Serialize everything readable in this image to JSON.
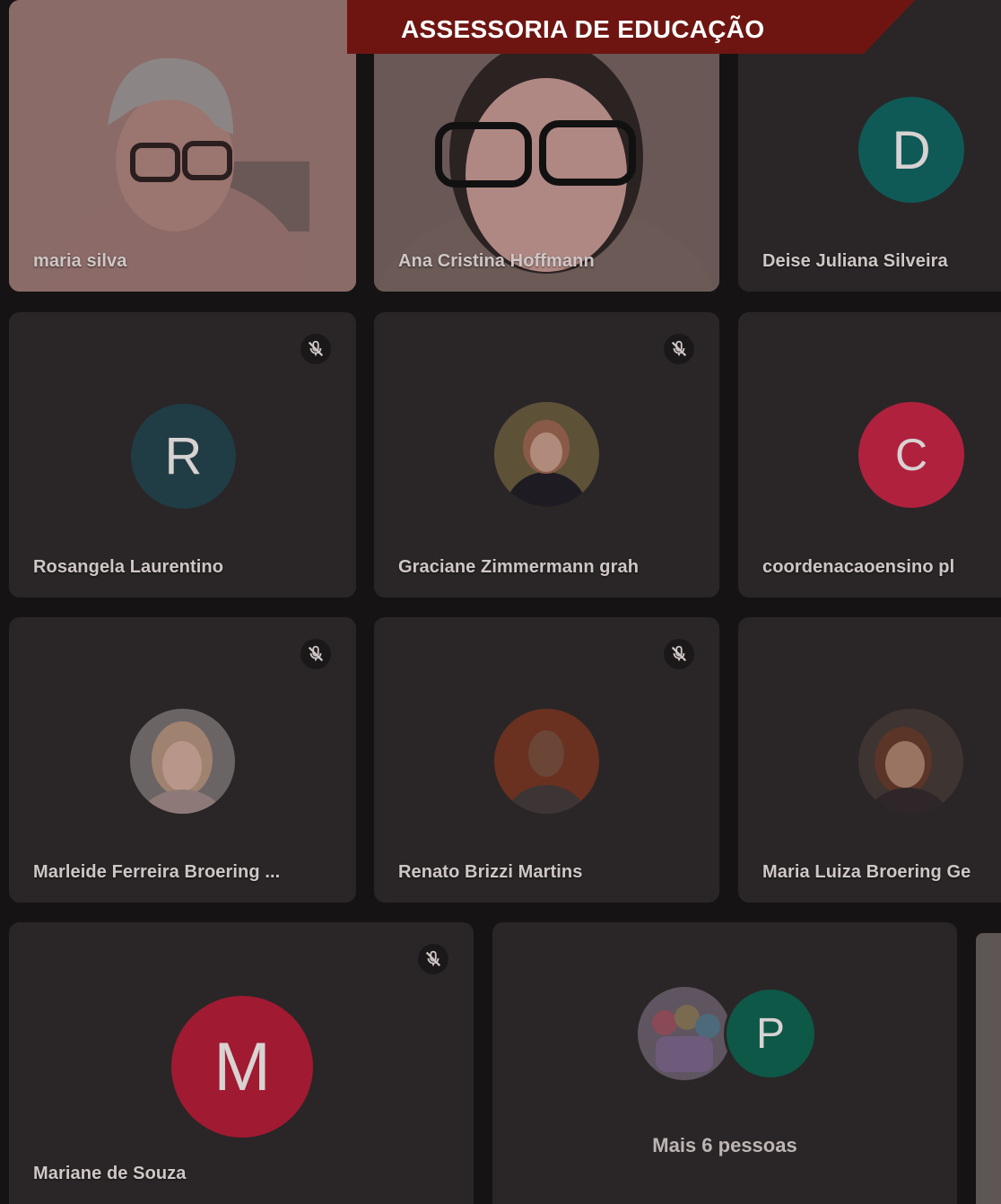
{
  "banner": {
    "text": "ASSESSORIA DE EDUCAÇÃO"
  },
  "participants": {
    "maria_silva": {
      "name": "maria silva"
    },
    "ana_cristina": {
      "name": "Ana Cristina Hoffmann"
    },
    "deise": {
      "name": "Deise Juliana Silveira",
      "initial": "D",
      "color": "#0f5a57"
    },
    "rosangela": {
      "name": "Rosangela Laurentino",
      "initial": "R",
      "color": "#203c45"
    },
    "graciane": {
      "name": "Graciane Zimmermann grah"
    },
    "coordenacao": {
      "name": "coordenacaoensino pl",
      "initial": "C",
      "color": "#b0213e"
    },
    "marleide": {
      "name": "Marleide Ferreira Broering ..."
    },
    "renato": {
      "name": "Renato Brizzi Martins"
    },
    "maria_luiza": {
      "name": "Maria Luiza Broering Ge"
    },
    "mariane": {
      "name": "Mariane de Souza",
      "initial": "M",
      "color": "#a01a31"
    }
  },
  "more": {
    "label": "Mais 6 pessoas",
    "avatar_initial": "P",
    "avatar_color": "#0e5848"
  },
  "icons": {
    "muted": "mic-off-icon"
  }
}
